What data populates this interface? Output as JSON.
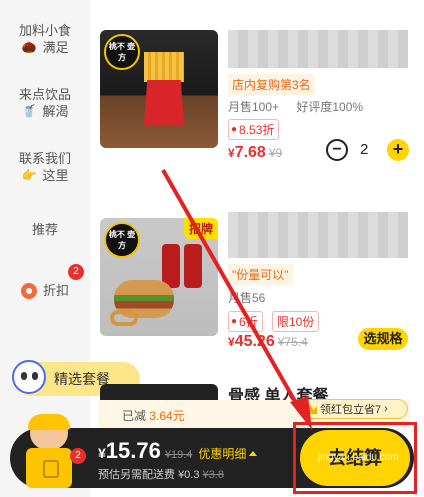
{
  "sidebar": {
    "items": [
      {
        "line1": "加料小食",
        "line2": "满足",
        "emoji": "🌰"
      },
      {
        "line1": "来点饮品",
        "line2": "解渴",
        "emoji": "🥤"
      },
      {
        "line1": "联系我们",
        "line2": "这里",
        "emoji": "👉"
      },
      {
        "label": "推荐"
      },
      {
        "label": "折扣",
        "badge": "2"
      }
    ]
  },
  "products": [
    {
      "brand_mark": "桃不 壶方",
      "rank_badge": "店内复购第3名",
      "monthly_sales": "月售100+",
      "rating": "好评度100%",
      "discount": "8.53折",
      "price": "7.68",
      "old_price": "¥9",
      "quantity": "2",
      "minus": "−",
      "plus": "+"
    },
    {
      "brand_mark": "桃不 壶方",
      "tag": "招牌",
      "quote": "\"份量可以\"",
      "monthly_sales": "月售56",
      "discount": "6折",
      "limit": "限10份",
      "price": "45.26",
      "old_price": "¥75.4",
      "spec_button": "选规格"
    }
  ],
  "combo": {
    "section_label": "精选套餐",
    "item_name": "骨感 单人套餐"
  },
  "cart": {
    "reduced_label": "已减",
    "reduced_amount": "3.64元",
    "coupon": "领红包立省7",
    "badge": "2",
    "total": "15.76",
    "old_total": "¥19.4",
    "detail_label": "优惠明细",
    "estimate_label": "预估另需配送费",
    "delivery_fee": "¥0.3",
    "delivery_old": "¥3.8",
    "checkout": "去结算"
  },
  "watermark": "jingyan.baidu.com",
  "colors": {
    "accent_yellow": "#ffd400",
    "price_red": "#e8302e",
    "cart_bar": "#222222",
    "annotation_red": "#e32222"
  }
}
